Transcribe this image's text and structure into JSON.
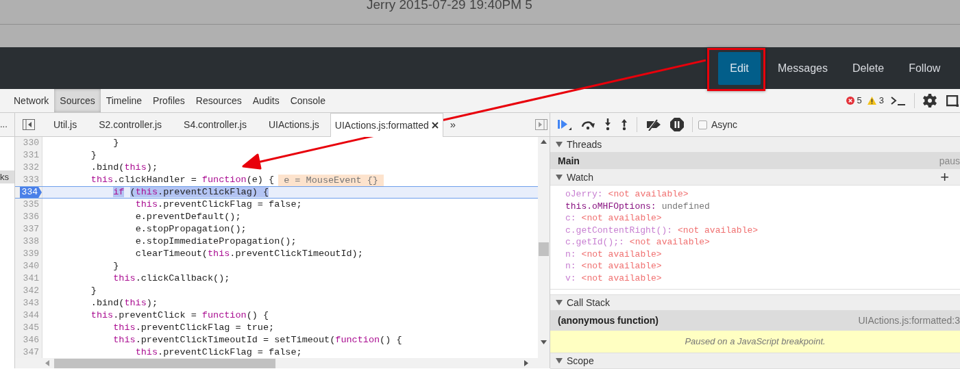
{
  "page_header": {
    "title": "Jerry 2015-07-29 19:40PM 5"
  },
  "nav": [
    {
      "label": "Edit",
      "kind": "primary"
    },
    {
      "label": "Messages",
      "kind": "link"
    },
    {
      "label": "Delete",
      "kind": "link"
    },
    {
      "label": "Follow",
      "kind": "link"
    }
  ],
  "devtools_tabs": [
    {
      "label": "Network",
      "selected": false
    },
    {
      "label": "Sources",
      "selected": true
    },
    {
      "label": "Timeline",
      "selected": false
    },
    {
      "label": "Profiles",
      "selected": false
    },
    {
      "label": "Resources",
      "selected": false
    },
    {
      "label": "Audits",
      "selected": false
    },
    {
      "label": "Console",
      "selected": false
    }
  ],
  "status": {
    "errors": "5",
    "warnings": "3"
  },
  "navigator": {
    "overflow_label": "...",
    "item": "ks"
  },
  "file_tabs": [
    {
      "label": "Util.js",
      "selected": false,
      "closable": false
    },
    {
      "label": "S2.controller.js",
      "selected": false,
      "closable": false
    },
    {
      "label": "S4.controller.js",
      "selected": false,
      "closable": false
    },
    {
      "label": "UIActions.js",
      "selected": false,
      "closable": false
    },
    {
      "label": "UIActions.js:formatted",
      "selected": true,
      "closable": true
    }
  ],
  "more_tabs": "»",
  "code": {
    "lines": [
      {
        "number": "330",
        "current": false,
        "tokens": [
          {
            "text": "            }",
            "kind": "plain"
          }
        ]
      },
      {
        "number": "331",
        "current": false,
        "tokens": [
          {
            "text": "        }",
            "kind": "plain"
          }
        ]
      },
      {
        "number": "332",
        "current": false,
        "tokens": [
          {
            "text": "        .bind(",
            "kind": "plain"
          },
          {
            "text": "this",
            "kind": "keyword"
          },
          {
            "text": ");",
            "kind": "plain"
          }
        ]
      },
      {
        "number": "333",
        "current": false,
        "inline_value": "e = MouseEvent {}",
        "tokens": [
          {
            "text": "        this",
            "kind": "keyword"
          },
          {
            "text": ".clickHandler = ",
            "kind": "plain"
          },
          {
            "text": "function",
            "kind": "keyword"
          },
          {
            "text": "(e) {",
            "kind": "plain"
          }
        ]
      },
      {
        "number": "334",
        "current": true,
        "tokens": [
          {
            "text": "            if",
            "kind": "keyword"
          },
          {
            "text": " (",
            "kind": "plain"
          },
          {
            "text": "this",
            "kind": "keyword"
          },
          {
            "text": ".preventClickFlag) {",
            "kind": "plain"
          }
        ]
      },
      {
        "number": "335",
        "current": false,
        "tokens": [
          {
            "text": "                this",
            "kind": "keyword"
          },
          {
            "text": ".preventClickFlag = false;",
            "kind": "plain"
          }
        ]
      },
      {
        "number": "336",
        "current": false,
        "tokens": [
          {
            "text": "                e.preventDefault();",
            "kind": "plain"
          }
        ]
      },
      {
        "number": "337",
        "current": false,
        "tokens": [
          {
            "text": "                e.stopPropagation();",
            "kind": "plain"
          }
        ]
      },
      {
        "number": "338",
        "current": false,
        "tokens": [
          {
            "text": "                e.stopImmediatePropagation();",
            "kind": "plain"
          }
        ]
      },
      {
        "number": "339",
        "current": false,
        "tokens": [
          {
            "text": "                clearTimeout(",
            "kind": "plain"
          },
          {
            "text": "this",
            "kind": "keyword"
          },
          {
            "text": ".preventClickTimeoutId);",
            "kind": "plain"
          }
        ]
      },
      {
        "number": "340",
        "current": false,
        "tokens": [
          {
            "text": "            }",
            "kind": "plain"
          }
        ]
      },
      {
        "number": "341",
        "current": false,
        "tokens": [
          {
            "text": "            this",
            "kind": "keyword"
          },
          {
            "text": ".clickCallback();",
            "kind": "plain"
          }
        ]
      },
      {
        "number": "342",
        "current": false,
        "tokens": [
          {
            "text": "        }",
            "kind": "plain"
          }
        ]
      },
      {
        "number": "343",
        "current": false,
        "tokens": [
          {
            "text": "        .bind(",
            "kind": "plain"
          },
          {
            "text": "this",
            "kind": "keyword"
          },
          {
            "text": ");",
            "kind": "plain"
          }
        ]
      },
      {
        "number": "344",
        "current": false,
        "tokens": [
          {
            "text": "        this",
            "kind": "keyword"
          },
          {
            "text": ".preventClick = ",
            "kind": "plain"
          },
          {
            "text": "function",
            "kind": "keyword"
          },
          {
            "text": "() {",
            "kind": "plain"
          }
        ]
      },
      {
        "number": "345",
        "current": false,
        "tokens": [
          {
            "text": "            this",
            "kind": "keyword"
          },
          {
            "text": ".preventClickFlag = true;",
            "kind": "plain"
          }
        ]
      },
      {
        "number": "346",
        "current": false,
        "tokens": [
          {
            "text": "            this",
            "kind": "keyword"
          },
          {
            "text": ".preventClickTimeoutId = setTimeout(",
            "kind": "plain"
          },
          {
            "text": "function",
            "kind": "keyword"
          },
          {
            "text": "() {",
            "kind": "plain"
          }
        ]
      },
      {
        "number": "347",
        "current": false,
        "tokens": [
          {
            "text": "                this",
            "kind": "keyword"
          },
          {
            "text": ".preventClickFlag = false;",
            "kind": "plain"
          }
        ]
      }
    ]
  },
  "debugger": {
    "async": {
      "label": "Async",
      "checked": false
    },
    "threads": {
      "title": "Threads",
      "expanded": true,
      "rows": [
        {
          "name": "Main",
          "status": "paus"
        }
      ]
    },
    "watch": {
      "title": "Watch",
      "expanded": true,
      "add": "+",
      "items": [
        {
          "expression": "oJerry:",
          "value": "<not available>",
          "available": false
        },
        {
          "expression": "this.oMHFOptions:",
          "value": "undefined",
          "available": true
        },
        {
          "expression": "c:",
          "value": "<not available>",
          "available": false
        },
        {
          "expression": "c.getContentRight():",
          "value": "<not available>",
          "available": false
        },
        {
          "expression": "c.getId();:",
          "value": "<not available>",
          "available": false
        },
        {
          "expression": "n:",
          "value": "<not available>",
          "available": false
        },
        {
          "expression": "n:",
          "value": "<not available>",
          "available": false
        },
        {
          "expression": "v:",
          "value": "<not available>",
          "available": false
        }
      ]
    },
    "call_stack": {
      "title": "Call Stack",
      "expanded": true,
      "frames": [
        {
          "name": "(anonymous function)",
          "location": "UIActions.js:formatted:3",
          "selected": true
        }
      ],
      "message": "Paused on a JavaScript breakpoint."
    },
    "scope": {
      "title": "Scope",
      "expanded": true
    }
  }
}
